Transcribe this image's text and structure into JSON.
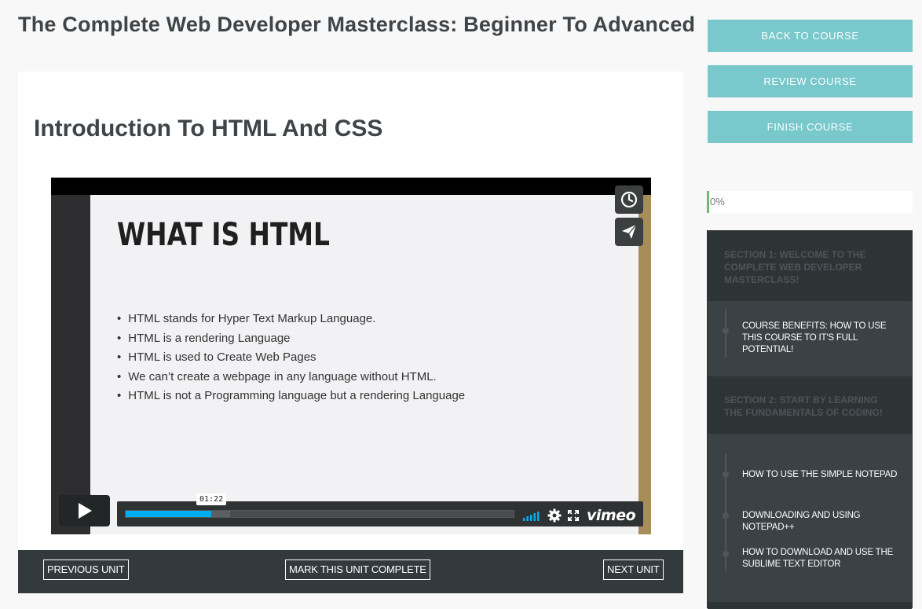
{
  "course": {
    "title": "The Complete Web Developer Masterclass: Beginner To Advanced"
  },
  "unit": {
    "title": "Introduction To HTML And CSS"
  },
  "video": {
    "slide_heading": "WHAT IS HTML",
    "bullets": [
      "HTML stands for Hyper Text Markup Language.",
      "HTML is a rendering Language",
      "HTML is used to Create Web Pages",
      "We can’t create a webpage in any language without HTML.",
      "HTML is not a Programming language but a rendering Language"
    ],
    "timestamp": "01:22",
    "progress_fraction": 0.22,
    "brand": "vimeo",
    "icons": {
      "watch_later": "clock-icon",
      "share": "paper-plane-icon",
      "play": "play-icon",
      "volume": "volume-bars-icon",
      "settings": "gear-icon",
      "fullscreen": "fullscreen-icon"
    },
    "accent_color": "#00adef"
  },
  "nav": {
    "previous": "PREVIOUS UNIT",
    "complete": "MARK THIS UNIT COMPLETE",
    "next": "NEXT UNIT"
  },
  "sidebar": {
    "buttons": {
      "back": "BACK TO COURSE",
      "review": "REVIEW COURSE",
      "finish": "FINISH COURSE"
    },
    "button_color": "#78c8cc",
    "progress": "0%",
    "sections": [
      {
        "title": "SECTION 1: WELCOME TO THE COMPLETE WEB DEVELOPER MASTERCLASS!",
        "units": [
          "COURSE BENEFITS: HOW TO USE THIS COURSE TO IT'S FULL POTENTIAL!"
        ]
      },
      {
        "title": "SECTION 2: START BY LEARNING THE FUNDAMENTALS OF CODING!",
        "units": [
          "HOW TO USE THE SIMPLE NOTEPAD",
          "DOWNLOADING AND USING NOTEPAD++",
          "HOW TO DOWNLOAD AND USE THE SUBLIME TEXT EDITOR"
        ]
      }
    ]
  }
}
